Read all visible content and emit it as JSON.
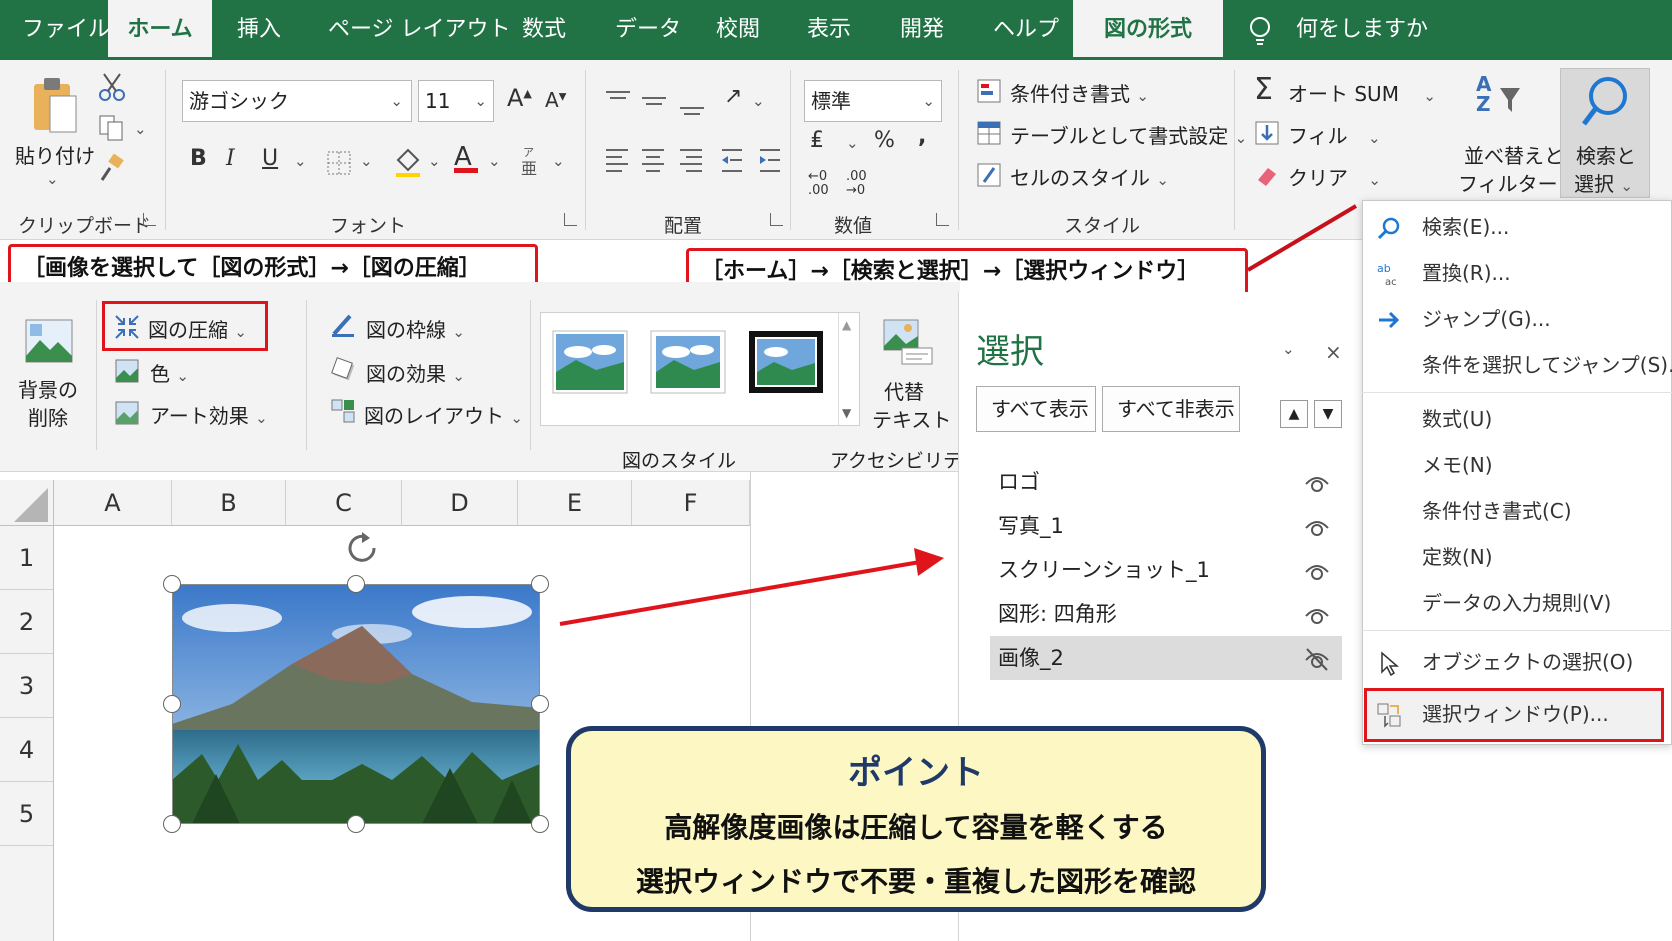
{
  "tabs": [
    "ファイル",
    "ホーム",
    "挿入",
    "ページ レイアウト",
    "数式",
    "データ",
    "校閲",
    "表示",
    "開発",
    "ヘルプ",
    "図の形式",
    "何をしますか"
  ],
  "ribbon": {
    "paste_label": "貼り付け",
    "font_name": "游ゴシック",
    "font_size": "11",
    "number_format": "標準",
    "cond_format": "条件付き書式",
    "table_format": "テーブルとして書式設定",
    "cell_styles": "セルのスタイル",
    "autosum": "オート SUM",
    "fill": "フィル",
    "clear": "クリア",
    "sort_filter_1": "並べ替えと",
    "sort_filter_2": "フィルター",
    "find_select_1": "検索と",
    "find_select_2": "選択",
    "groups": {
      "clipboard": "クリップボード",
      "font": "フォント",
      "alignment": "配置",
      "number": "数値",
      "styles": "スタイル"
    },
    "bold": "B",
    "italic": "I",
    "underline": "U",
    "percent": "%",
    "comma": ",",
    "increase_font": "A",
    "decrease_font": "A",
    "font_color": "A",
    "sort_az_a": "A",
    "sort_az_z": "Z",
    "inc_decimal": ".00",
    "dec_decimal": ".00"
  },
  "callouts": {
    "left": "［画像を選択して［図の形式］→［図の圧縮］",
    "right": "［ホーム］→［検索と選択］→［選択ウィンドウ］"
  },
  "picture_format": {
    "remove_bg_1": "背景の",
    "remove_bg_2": "削除",
    "compress": "図の圧縮",
    "color": "色",
    "artistic": "アート効果",
    "border": "図の枠線",
    "effects": "図の効果",
    "layout": "図のレイアウト",
    "styles_label": "図のスタイル",
    "alt_text_1": "代替",
    "alt_text_2": "テキスト",
    "accessibility_label": "アクセシビリティ"
  },
  "sheet": {
    "columns": [
      "A",
      "B",
      "C",
      "D",
      "E",
      "F"
    ],
    "rows": [
      "1",
      "2",
      "3",
      "4",
      "5"
    ]
  },
  "selection_pane": {
    "title": "選択",
    "show_all": "すべて表示",
    "hide_all": "すべて非表示",
    "items": [
      "ロゴ",
      "写真_1",
      "スクリーンショット_1",
      "図形: 四角形",
      "画像_2"
    ]
  },
  "menu": {
    "items": [
      "検索(E)...",
      "置換(R)...",
      "ジャンプ(G)...",
      "条件を選択してジャンプ(S)...",
      "数式(U)",
      "メモ(N)",
      "条件付き書式(C)",
      "定数(N)",
      "データの入力規則(V)",
      "オブジェクトの選択(O)",
      "選択ウィンドウ(P)..."
    ]
  },
  "point": {
    "title": "ポイント",
    "line1": "高解像度画像は圧縮して容量を軽くする",
    "line2": "選択ウィンドウで不要・重複した図形を確認"
  },
  "colors": {
    "excel_green": "#217346",
    "callout_red": "#e0151c",
    "point_bg": "#fdf8c3",
    "point_border": "#1f3a68"
  }
}
